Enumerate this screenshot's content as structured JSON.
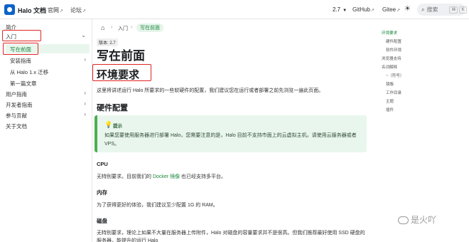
{
  "navbar": {
    "brand": "Halo 文档",
    "links": [
      {
        "label": "官网",
        "ext": "↗"
      },
      {
        "label": "论坛",
        "ext": "↗"
      }
    ],
    "version": "2.7",
    "right_links": [
      {
        "label": "GitHub",
        "ext": "↗"
      },
      {
        "label": "Gitee",
        "ext": "↗"
      }
    ],
    "search": {
      "placeholder": "搜索",
      "shortcut_1": "⌘",
      "shortcut_2": "K"
    }
  },
  "sidebar": {
    "items": [
      {
        "label": "简介"
      },
      {
        "label": "入门"
      },
      {
        "label": "写在前面"
      },
      {
        "label": "安装指南"
      },
      {
        "label": "从 Halo 1.x 迁移"
      },
      {
        "label": "第一篇文章"
      },
      {
        "label": "用户指南"
      },
      {
        "label": "开发者指南"
      },
      {
        "label": "参与贡献"
      },
      {
        "label": "关于文档"
      }
    ]
  },
  "breadcrumb": {
    "parent": "入门",
    "current": "写在前面",
    "sep": "›"
  },
  "content": {
    "version_badge": "版本: 2.7",
    "title": "写在前面",
    "h2": "环境要求",
    "intro": "这里将讲述运行 Halo 所要求的一些软硬件的配置，我们建议您在运行或者部署之前先浏览一遍此页面。",
    "h3_hardware": "硬件配置",
    "tip": {
      "label": "提示",
      "text": "如果您要使用服务器进行部署 Halo，您需要注意的是，Halo 目前不支持市面上的云虚拟主机，请使用云服务器或者 VPS。"
    },
    "cpu_title": "CPU",
    "cpu_text_1": "无特别要求。目前我们的 ",
    "cpu_link": "Docker 镜像",
    "cpu_text_2": " 也已经支持多平台。",
    "mem_title": "内存",
    "mem_text": "为了获得更好的体验，我们建议至少配置 1G 的 RAM。",
    "disk_title": "磁盘",
    "disk_text": "无特别要求，理论上如果不大量在服务器上传附件，Halo 对磁盘的容量要求并不是很高。但我们推荐最好使用 SSD 硬盘的服务器，能提升的运行 Halo"
  },
  "toc": [
    {
      "label": "环境要求",
      "active": true
    },
    {
      "label": "硬件配置"
    },
    {
      "label": "软件环境"
    },
    {
      "label": "浏览器支持"
    },
    {
      "label": "名词解释"
    },
    {
      "label": "~（符号）"
    },
    {
      "label": "镜像"
    },
    {
      "label": "工作目录"
    },
    {
      "label": "主题"
    },
    {
      "label": "插件"
    }
  ],
  "watermark": {
    "text": "是火吖"
  }
}
